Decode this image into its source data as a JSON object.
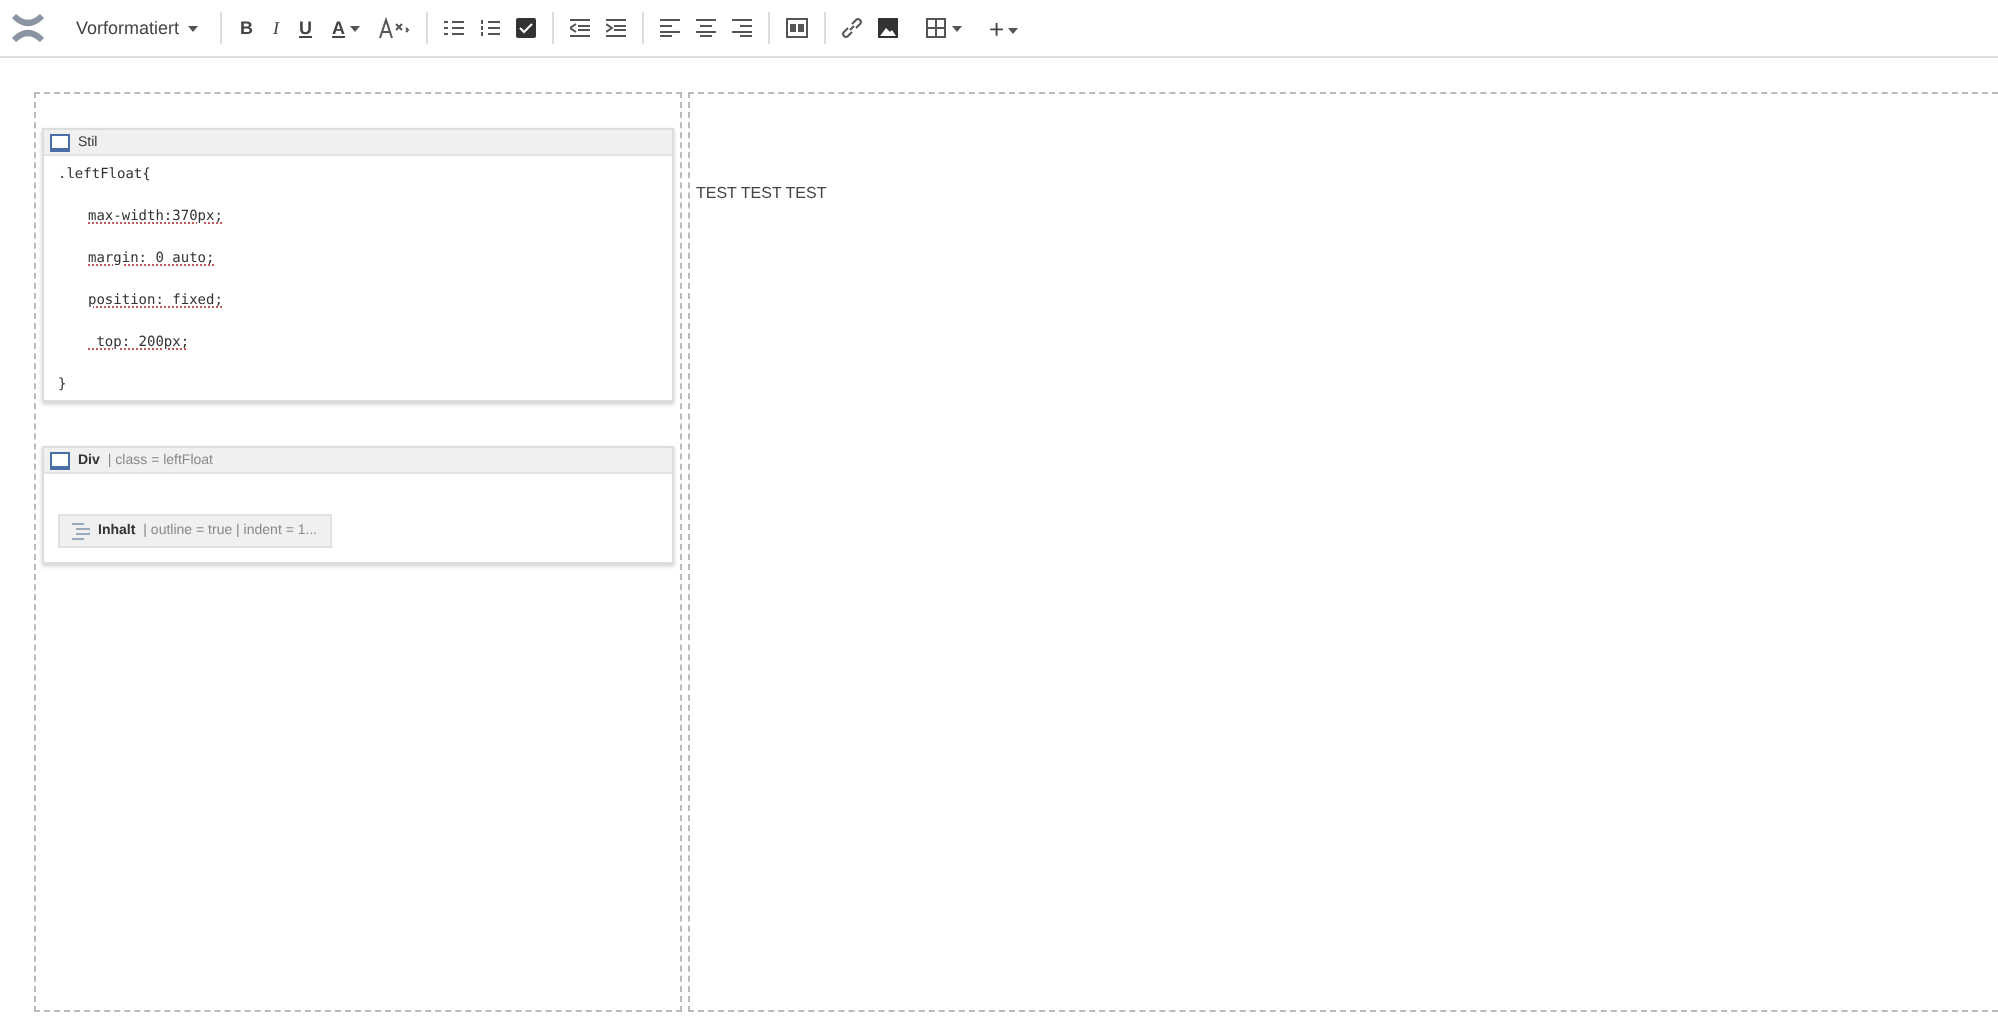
{
  "toolbar": {
    "format_dropdown": "Vorformatiert",
    "bold": "B",
    "italic": "I",
    "underline": "U",
    "text_color": "A",
    "insert": "+"
  },
  "left_column": {
    "style_macro": {
      "title": "Stil",
      "code": [
        {
          "kind": "selector",
          "text": ".leftFloat{"
        },
        {
          "kind": "property",
          "text": "max-width:370px;"
        },
        {
          "kind": "property",
          "text": "margin: 0 auto;"
        },
        {
          "kind": "property",
          "text": "position: fixed;"
        },
        {
          "kind": "property",
          "text": " top: 200px;"
        },
        {
          "kind": "brace",
          "text": "}"
        }
      ]
    },
    "div_macro": {
      "title": "Div",
      "params": "| class = leftFloat",
      "child": {
        "title": "Inhalt",
        "params": "| outline = true | indent = 1..."
      }
    }
  },
  "right_column": {
    "text": "TEST TEST TEST"
  }
}
